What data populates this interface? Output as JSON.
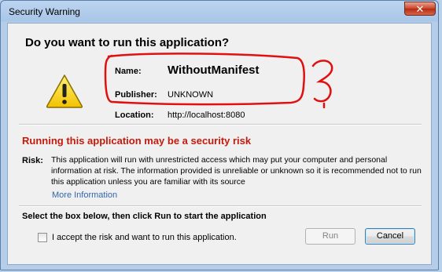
{
  "window": {
    "title": "Security Warning",
    "close_symbol": "✕",
    "close_icon": "close-icon"
  },
  "dialog": {
    "heading": "Do you want to run this application?",
    "icon": "warning-icon",
    "name_label": "Name:",
    "name_value": "WithoutManifest",
    "publisher_label": "Publisher:",
    "publisher_value": "UNKNOWN",
    "location_label": "Location:",
    "location_value": "http://localhost:8080"
  },
  "risk": {
    "heading": "Running this application may be a security risk",
    "label": "Risk:",
    "text": "This application will run with unrestricted access which may put your computer and personal information at risk. The information provided is unreliable or unknown so it is recommended not to run this application unless you are familiar with its source",
    "more_info_link": "More Information"
  },
  "footer": {
    "instruction": "Select the box below, then click Run to start the application",
    "checkbox_label": "I accept the risk and want to run this application.",
    "checkbox_checked": false,
    "run_label": "Run",
    "run_enabled": false,
    "cancel_label": "Cancel"
  },
  "colors": {
    "risk_heading": "#c41a0d",
    "link": "#3366aa",
    "annotation": "#e01010"
  }
}
